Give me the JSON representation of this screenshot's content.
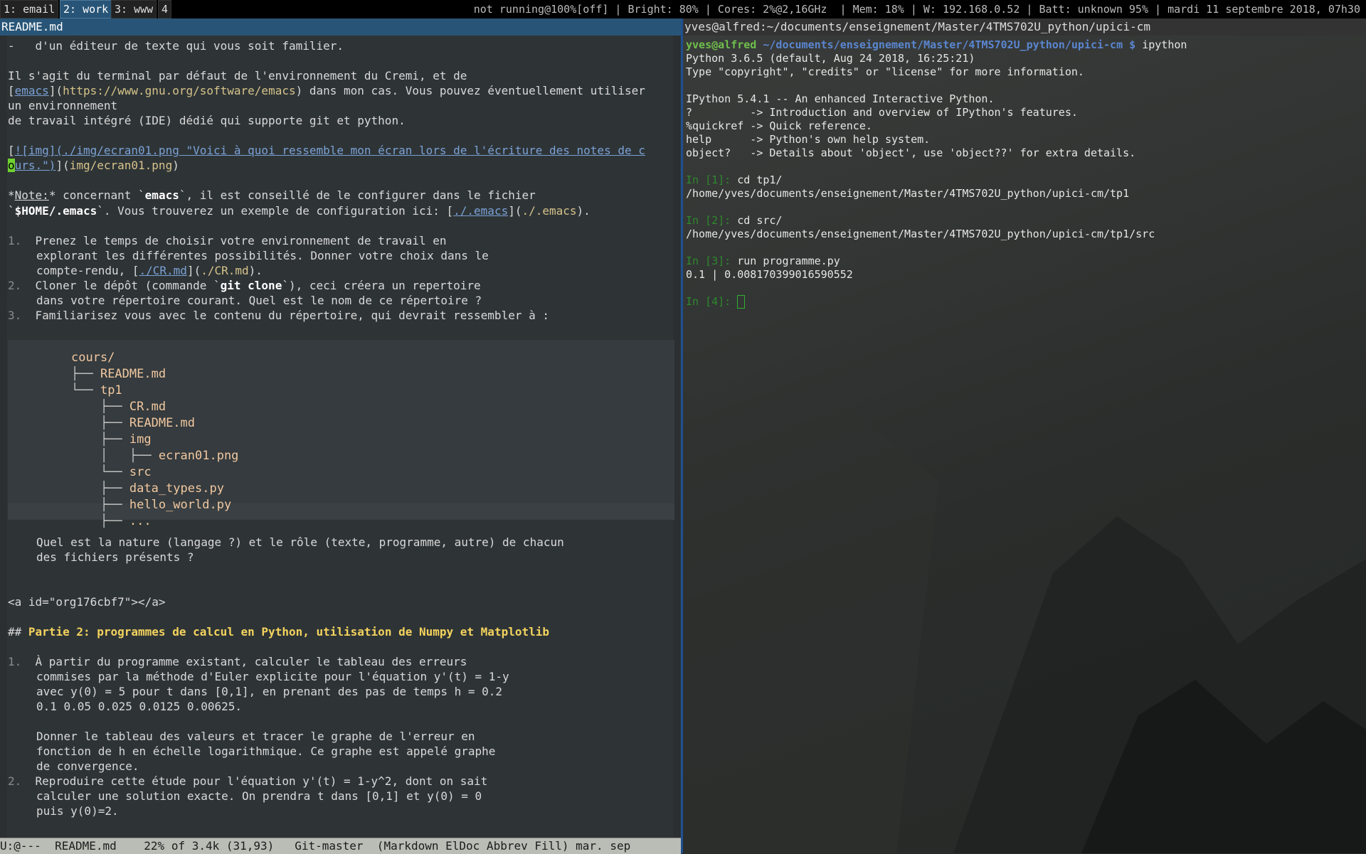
{
  "topbar": {
    "workspaces": [
      {
        "label": "1: email",
        "active": false
      },
      {
        "label": "2: work",
        "active": true
      },
      {
        "label": "3: www",
        "active": false
      },
      {
        "label": "4",
        "active": false
      }
    ],
    "status": "not running@100%[off] | Bright: 80% | Cores: 2%@2,16GHz  | Mem: 18% | W: 192.168.0.52 | Batt: unknown 95% | mardi 11 septembre 2018, 07h30"
  },
  "emacs": {
    "window_title": "README.md",
    "lines": {
      "l1": "-   d'un éditeur de texte qui vous soit familier.",
      "l3": "Il s'agit du terminal par défaut de l'environnement du Cremi, et de",
      "l4a": "[",
      "l4b": "emacs",
      "l4c": "](",
      "l4d": "https://www.gnu.org/software/emacs",
      "l4e": ") dans mon cas. Vous pouvez éventuellement utiliser",
      "l5": "un environnement",
      "l6": "de travail intégré (IDE) dédié qui supporte git et python.",
      "l8a": "[",
      "l8b": "![img](./img/ecran01.png \"Voici à quoi ressemble mon écran lors de l'écriture des notes de c",
      "l9a": "o",
      "l9b": "urs.\")",
      "l9c": "](",
      "l9d": "img/ecran01.png",
      "l9e": ")",
      "l11a": "*",
      "l11b": "Note:",
      "l11c": "* concernant `",
      "l11d": "emacs",
      "l11e": "`, il est conseillé de le configurer dans le fichier",
      "l12a": "`",
      "l12b": "$HOME/.emacs",
      "l12c": "`. Vous trouverez un exemple de configuration ici: [",
      "l12d": "./.emacs",
      "l12e": "](",
      "l12f": "./.emacs",
      "l12g": ").",
      "l14n": "1.",
      "l14": "Prenez le temps de choisir votre environnement de travail en",
      "l15": "explorant les différentes possibilités. Donner votre choix dans le",
      "l16a": "compte-rendu, [",
      "l16b": "./CR.md",
      "l16c": "](",
      "l16d": "./CR.md",
      "l16e": ").",
      "l17n": "2.",
      "l17a": "Cloner le dépôt (commande `",
      "l17b": "git clone",
      "l17c": "`), ceci créera un repertoire",
      "l18": "dans votre répertoire courant. Quel est le nom de ce répertoire ?",
      "l19n": "3.",
      "l19": "Familiarisez vous avec le contenu du répertoire, qui devrait ressembler à :",
      "q1": "Quel est la nature (langage ?) et le rôle (texte, programme, autre) de chacun",
      "q2": "des fichiers présents ?",
      "anchor": "<a id=\"org176cbf7\"></a>",
      "h2a": "## ",
      "h2b": "Partie 2: programmes de calcul en Python, utilisation de Numpy et Matplotlib",
      "p1n": "1.",
      "p1": "À partir du programme existant, calculer le tableau des erreurs",
      "p2": "commises par la méthode d'Euler explicite pour l'équation y'(t) = 1-y",
      "p3": "avec y(0) = 5 pour t dans [0,1], en prenant des pas de temps h = 0.2",
      "p4": "0.1 0.05 0.025 0.0125 0.00625.",
      "p6": "Donner le tableau des valeurs et tracer le graphe de l'erreur en",
      "p7": "fonction de h en échelle logarithmique. Ce graphe est appelé graphe",
      "p8": "de convergence.",
      "p9n": "2.",
      "p9": "Reproduire cette étude pour l'équation y'(t) = 1-y^2, dont on sait",
      "p10": "calculer une solution exacte. On prendra t dans [0,1] et y(0) = 0",
      "p11": "puis y(0)=2."
    },
    "tree": {
      "root": "cours/",
      "items": [
        {
          "branch": "├── ",
          "name": "README.md"
        },
        {
          "branch": "└── ",
          "name": "tp1"
        },
        {
          "branch": "    ├── ",
          "name": "CR.md"
        },
        {
          "branch": "    ├── ",
          "name": "README.md"
        },
        {
          "branch": "    ├── ",
          "name": "img"
        },
        {
          "branch": "    │   ├── ",
          "name": "ecran01.png"
        },
        {
          "branch": "    └── ",
          "name": "src"
        },
        {
          "branch": "    ├── ",
          "name": "data_types.py"
        },
        {
          "branch": "    ├── ",
          "name": "hello_world.py"
        },
        {
          "branch": "    ├── ",
          "name": "..."
        }
      ]
    },
    "modeline": "U:@---  README.md    22% of 3.4k (31,93)   Git-master  (Markdown ElDoc Abbrev Fill) mar. sep"
  },
  "terminal": {
    "title": "yves@alfred:~/documents/enseignement/Master/4TMS702U_python/upici-cm",
    "prompt_user": "yves@alfred",
    "prompt_path": "~/documents/enseignement/Master/4TMS702U_python/upici-cm $",
    "command": " ipython",
    "lines": {
      "t2": "Python 3.6.5 (default, Aug 24 2018, 16:25:21)",
      "t3": "Type \"copyright\", \"credits\" or \"license\" for more information.",
      "t5": "IPython 5.4.1 -- An enhanced Interactive Python.",
      "t6": "?         -> Introduction and overview of IPython's features.",
      "t7": "%quickref -> Quick reference.",
      "t8": "help      -> Python's own help system.",
      "t9": "object?   -> Details about 'object', use 'object??' for extra details.",
      "in1": "In [1]:",
      "c1": " cd tp1/",
      "o1": "/home/yves/documents/enseignement/Master/4TMS702U_python/upici-cm/tp1",
      "in2": "In [2]:",
      "c2": " cd src/",
      "o2": "/home/yves/documents/enseignement/Master/4TMS702U_python/upici-cm/tp1/src",
      "in3": "In [3]:",
      "c3": " run programme.py",
      "o3": "0.1 | 0.008170399016590552",
      "in4": "In [4]:"
    }
  }
}
